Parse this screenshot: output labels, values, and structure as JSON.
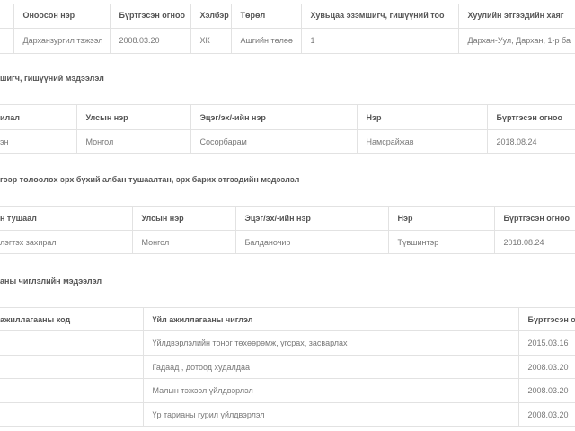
{
  "company": {
    "headers": [
      "",
      "Оноосон нэр",
      "Бүртгэсэн огноо",
      "Хэлбэр",
      "Төрөл",
      "Хувьцаа эзэмшигч, гишүүний тоо",
      "Хуулийн этгээдийн хаяг"
    ],
    "row": [
      "",
      "Дарханзургил тэжээл",
      "2008.03.20",
      "ХК",
      "Ашгийн төлөө",
      "1",
      "Дархан-Уул, Дархан, 1-р ба"
    ]
  },
  "shareholders": {
    "title": "шигч, гишүүний мэдээлэл",
    "headers": [
      "илал",
      "Улсын нэр",
      "Эцэг/эх/-ийн нэр",
      "Нэр",
      "Бүртгэсэн огноо"
    ],
    "row": [
      "эн",
      "Монгол",
      "Сосорбарам",
      "Намсрайжав",
      "2018.08.24"
    ]
  },
  "officials": {
    "title": "гээр төлөөлөх эрх бүхий албан тушаалтан, эрх барих этгээдийн мэдээлэл",
    "headers": [
      "н тушаал",
      "Улсын нэр",
      "Эцэг/эх/-ийн нэр",
      "Нэр",
      "Бүртгэсэн огноо"
    ],
    "row": [
      "лэгтэх захирал",
      "Монгол",
      "Балданочир",
      "Түвшинтэр",
      "2018.08.24"
    ]
  },
  "activities": {
    "title": "аны чиглэлийн мэдээлэл",
    "headers": [
      "ажиллагааны код",
      "Үйл ажиллагааны чиглэл",
      "Бүртгэсэн огноо"
    ],
    "rows": [
      [
        "",
        "Үйлдвэрлэлийн тоног төхөөрөмж, угсрах, засварлах",
        "2015.03.16"
      ],
      [
        "",
        "Гадаад , дотоод худалдаа",
        "2008.03.20"
      ],
      [
        "",
        "Малын тэжээл үйлдвэрлэл",
        "2008.03.20"
      ],
      [
        "",
        "Үр тарианы гурил үйлдвэрлэл",
        "2008.03.20"
      ]
    ]
  }
}
